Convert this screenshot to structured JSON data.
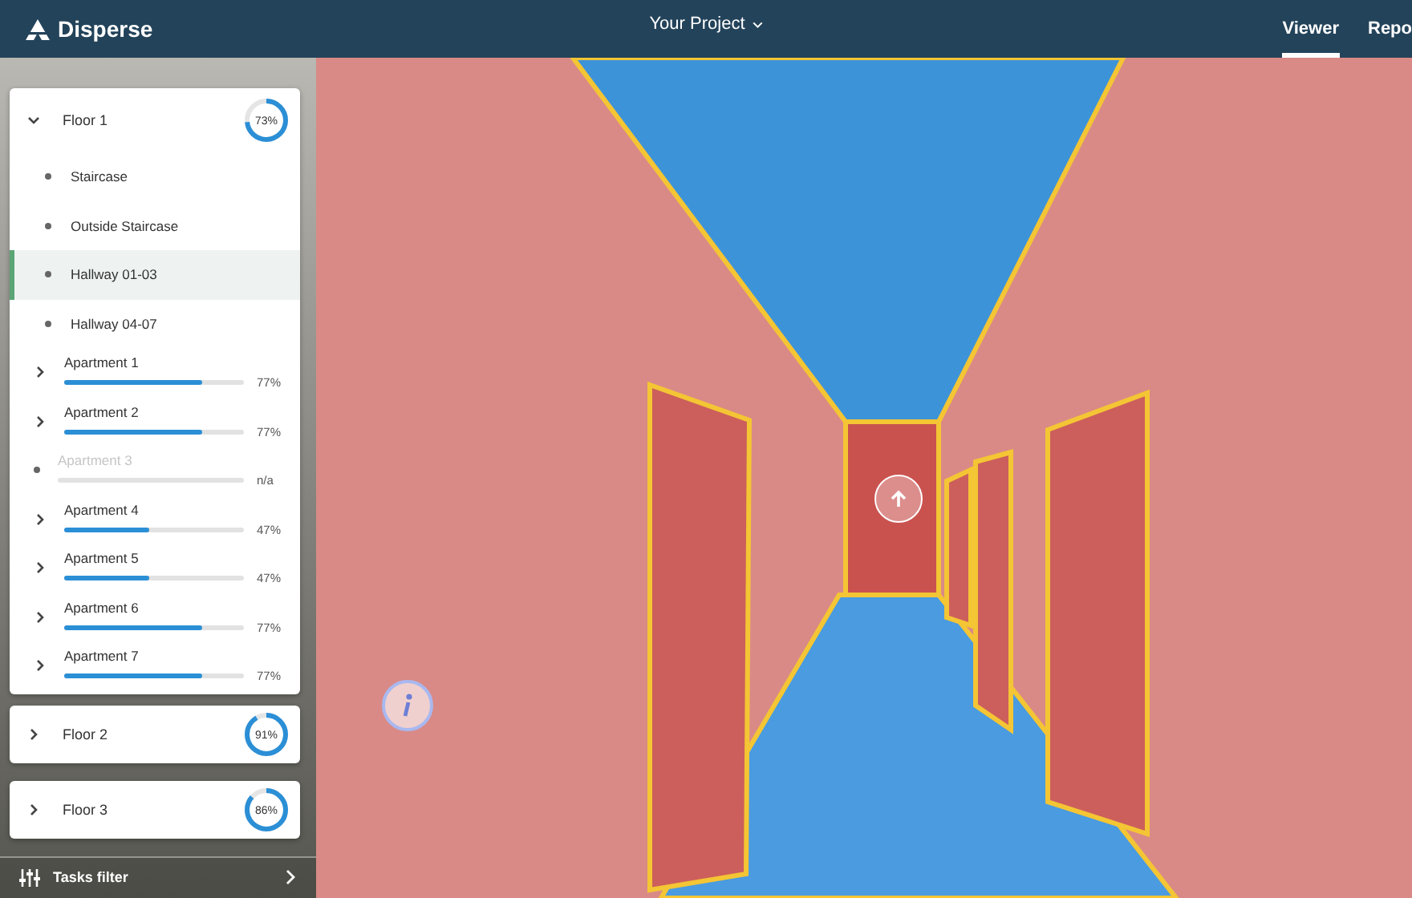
{
  "header": {
    "logo": "Disperse",
    "project": "Your Project",
    "tabs": [
      {
        "label": "Viewer",
        "selected": true
      },
      {
        "label": "Repo",
        "selected": false
      }
    ]
  },
  "floors": [
    {
      "name": "Floor 1",
      "progress": "73%",
      "level": 0.73,
      "expanded": true,
      "items": [
        {
          "kind": "area",
          "name": "Staircase",
          "selected": false
        },
        {
          "kind": "area",
          "name": "Outside Staircase",
          "selected": false
        },
        {
          "kind": "area",
          "name": "Hallway 01-03",
          "selected": true
        },
        {
          "kind": "area",
          "name": "Hallway 04-07",
          "selected": false
        },
        {
          "kind": "apartment",
          "name": "Apartment 1",
          "progress": "77%",
          "level": 0.77,
          "disabled": false
        },
        {
          "kind": "apartment",
          "name": "Apartment 2",
          "progress": "77%",
          "level": 0.77,
          "disabled": false
        },
        {
          "kind": "apartment",
          "name": "Apartment 3",
          "progress": "n/a",
          "disabled": true
        },
        {
          "kind": "apartment",
          "name": "Apartment 4",
          "progress": "47%",
          "level": 0.47,
          "disabled": false
        },
        {
          "kind": "apartment",
          "name": "Apartment 5",
          "progress": "47%",
          "level": 0.47,
          "disabled": false
        },
        {
          "kind": "apartment",
          "name": "Apartment 6",
          "progress": "77%",
          "level": 0.77,
          "disabled": false
        },
        {
          "kind": "apartment",
          "name": "Apartment 7",
          "progress": "77%",
          "level": 0.77,
          "disabled": false
        }
      ]
    },
    {
      "name": "Floor 2",
      "progress": "91%",
      "level": 0.91,
      "expanded": false
    },
    {
      "name": "Floor 3",
      "progress": "86%",
      "level": 0.86,
      "expanded": false
    }
  ],
  "footer": {
    "label": "Tasks filter"
  }
}
